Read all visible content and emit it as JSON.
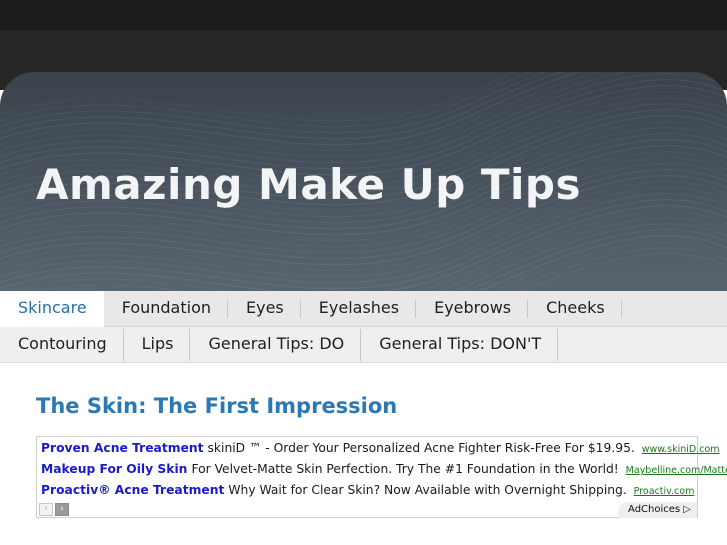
{
  "header": {
    "site_title": "Amazing Make Up Tips"
  },
  "nav": {
    "row1": [
      {
        "label": "Skincare",
        "active": true
      },
      {
        "label": "Foundation"
      },
      {
        "label": "Eyes"
      },
      {
        "label": "Eyelashes"
      },
      {
        "label": "Eyebrows"
      },
      {
        "label": "Cheeks"
      }
    ],
    "row2": [
      {
        "label": "Contouring"
      },
      {
        "label": "Lips"
      },
      {
        "label": "General Tips: DO"
      },
      {
        "label": "General Tips: DON'T"
      }
    ]
  },
  "post": {
    "title": "The Skin: The First Impression"
  },
  "ads": {
    "items": [
      {
        "title": "Proven Acne Treatment",
        "text": "skiniD ™ - Order Your Personalized Acne Fighter Risk-Free For $19.95.",
        "url": "www.skiniD.com"
      },
      {
        "title": "Makeup For Oily Skin",
        "text": "For Velvet-Matte Skin Perfection. Try The #1 Foundation in the World!",
        "url": "Maybelline.com/Matte-F"
      },
      {
        "title": "Proactiv® Acne Treatment",
        "text": "Why Wait for Clear Skin? Now Available with Overnight Shipping.",
        "url": "Proactiv.com"
      }
    ],
    "prev_glyph": "‹",
    "next_glyph": "›",
    "adchoices_label": "AdChoices ▷"
  }
}
